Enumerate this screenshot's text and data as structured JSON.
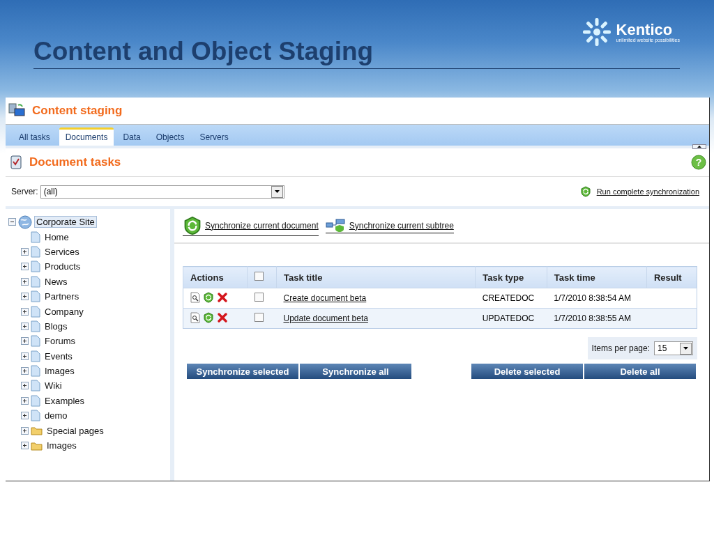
{
  "slide": {
    "title": "Content and Object Staging",
    "logo": {
      "name": "Kentico",
      "tagline": "unlimited website possibilities"
    }
  },
  "app": {
    "title": "Content staging",
    "tabs": [
      {
        "label": "All tasks",
        "selected": false
      },
      {
        "label": "Documents",
        "selected": true
      },
      {
        "label": "Data",
        "selected": false
      },
      {
        "label": "Objects",
        "selected": false
      },
      {
        "label": "Servers",
        "selected": false
      }
    ],
    "section_title": "Document tasks",
    "help": "?",
    "server": {
      "label": "Server:",
      "value": "(all)"
    },
    "run_link": "Run complete synchronization",
    "tree": [
      {
        "label": "Corporate Site",
        "kind": "site",
        "selected": true,
        "expanded": true,
        "children": [
          {
            "label": "Home",
            "kind": "leaf"
          },
          {
            "label": "Services",
            "kind": "page"
          },
          {
            "label": "Products",
            "kind": "page"
          },
          {
            "label": "News",
            "kind": "page"
          },
          {
            "label": "Partners",
            "kind": "page"
          },
          {
            "label": "Company",
            "kind": "page"
          },
          {
            "label": "Blogs",
            "kind": "page"
          },
          {
            "label": "Forums",
            "kind": "page"
          },
          {
            "label": "Events",
            "kind": "page"
          },
          {
            "label": "Images",
            "kind": "page"
          },
          {
            "label": "Wiki",
            "kind": "page"
          },
          {
            "label": "Examples",
            "kind": "page"
          },
          {
            "label": "demo",
            "kind": "page"
          },
          {
            "label": "Special pages",
            "kind": "folder"
          },
          {
            "label": "Images",
            "kind": "folder"
          }
        ]
      }
    ],
    "sync_links": [
      {
        "label": "Synchronize current document",
        "kind": "document"
      },
      {
        "label": "Synchronize current subtree",
        "kind": "subtree"
      }
    ],
    "table": {
      "columns": [
        {
          "label": "Actions",
          "kind": "text"
        },
        {
          "kind": "checkbox",
          "checked": false
        },
        {
          "label": "Task title",
          "kind": "text"
        },
        {
          "label": "Task type",
          "kind": "text"
        },
        {
          "label": "Task time",
          "kind": "text"
        },
        {
          "label": "Result",
          "kind": "text"
        }
      ],
      "rows": [
        {
          "checked": false,
          "title": "Create document beta",
          "type": "CREATEDOC",
          "time": "1/7/2010 8:38:54 AM"
        },
        {
          "checked": false,
          "title": "Update document beta",
          "type": "UPDATEDOC",
          "time": "1/7/2010 8:38:55 AM"
        }
      ]
    },
    "pager": {
      "label": "Items per page:",
      "value": "15"
    },
    "sync_buttons": [
      "Synchronize selected",
      "Synchronize all"
    ],
    "delete_buttons": [
      "Delete selected",
      "Delete all"
    ]
  }
}
